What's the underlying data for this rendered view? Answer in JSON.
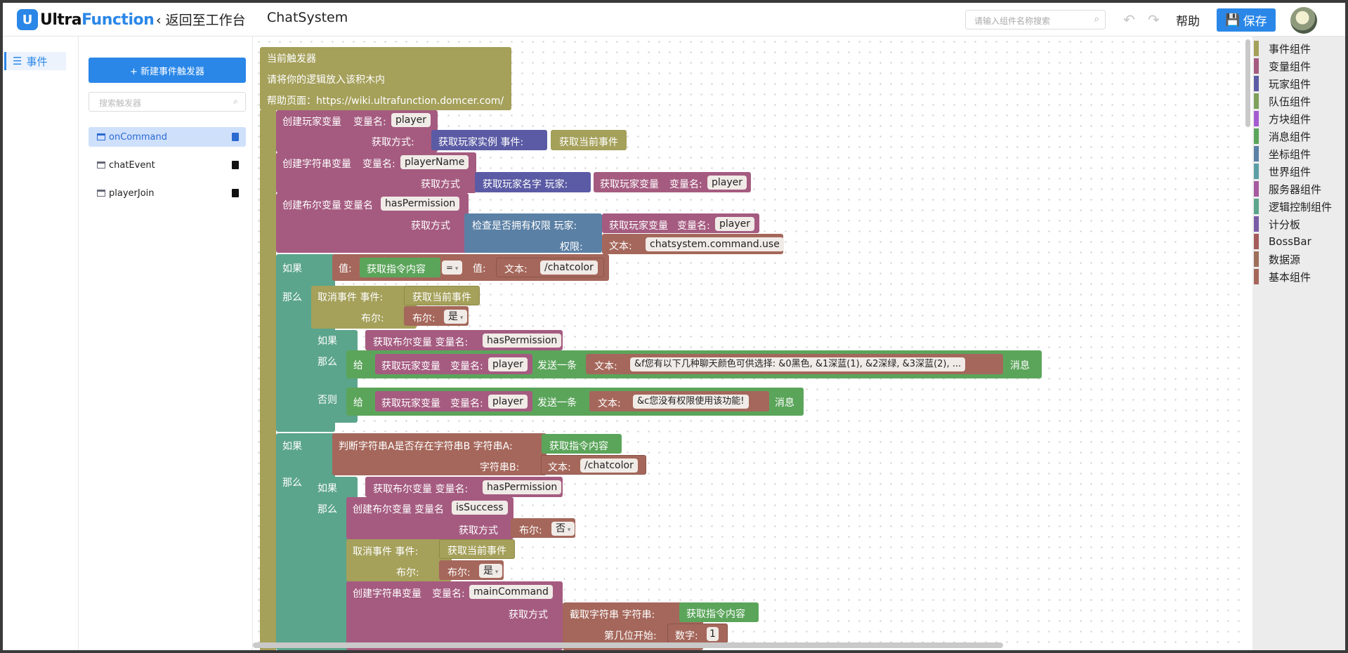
{
  "header": {
    "logo_badge": "U",
    "logo_part1": "Ultra",
    "logo_part2": "Function",
    "back_label": "返回至工作台",
    "system_name": "ChatSystem",
    "search_placeholder": "请输入组件名称搜索",
    "help_label": "帮助",
    "save_label": "保存"
  },
  "nav": {
    "active_label": "事件"
  },
  "triggers": {
    "new_button_label": "+ 新建事件触发器",
    "search_placeholder": "搜索触发器",
    "items": [
      {
        "label": "onCommand",
        "selected": true
      },
      {
        "label": "chatEvent",
        "selected": false
      },
      {
        "label": "playerJoin",
        "selected": false
      }
    ]
  },
  "palette": [
    {
      "label": "事件组件",
      "color": "#a5a05a"
    },
    {
      "label": "变量组件",
      "color": "#a55b80"
    },
    {
      "label": "玩家组件",
      "color": "#5b5ba5"
    },
    {
      "label": "队伍组件",
      "color": "#7ea05a"
    },
    {
      "label": "方块组件",
      "color": "#a55bd0"
    },
    {
      "label": "消息组件",
      "color": "#5ba55b"
    },
    {
      "label": "坐标组件",
      "color": "#5b80a5"
    },
    {
      "label": "世界组件",
      "color": "#5b9fa5"
    },
    {
      "label": "服务器组件",
      "color": "#a55b9f"
    },
    {
      "label": "逻辑控制组件",
      "color": "#5ba58c"
    },
    {
      "label": "计分板",
      "color": "#7a5ba5"
    },
    {
      "label": "BossBar",
      "color": "#a55b5b"
    },
    {
      "label": "数据源",
      "color": "#9e6f5a"
    },
    {
      "label": "基本组件",
      "color": "#a5675b"
    }
  ],
  "colors": {
    "event": "#a5a05a",
    "variable": "#a55b80",
    "player": "#5b5ba5",
    "logic": "#5ba58c",
    "message": "#5ba55b",
    "position": "#5b80a5",
    "text": "#a5675b",
    "accent": "#2a87e8"
  },
  "blocks": {
    "trigger_title": "当前触发器",
    "trigger_line2": "请将你的逻辑放入该积木内",
    "trigger_line3": "帮助页面：https://wiki.ultrafunction.domcer.com/",
    "create_player_var": "创建玩家变量",
    "var_name_label": "变量名:",
    "var_name_label_b": "变量名",
    "player_val": "player",
    "get_method_colon": "获取方式:",
    "get_method": "获取方式",
    "get_player_instance": "获取玩家实例 事件:",
    "get_current_event": "获取当前事件",
    "create_string_var": "创建字符串变量",
    "player_name_val": "playerName",
    "get_player_name": "获取玩家名字 玩家:",
    "get_player_var": "获取玩家变量",
    "create_bool_var": "创建布尔变量",
    "has_permission_val": "hasPermission",
    "check_permission": "检查是否拥有权限 玩家:",
    "permission_label": "权限:",
    "text_label": "文本:",
    "permission_val": "chatsystem.command.use",
    "if_label": "如果",
    "then_label": "那么",
    "else_label": "否则",
    "value_label": "值:",
    "get_command_content": "获取指令内容",
    "eq_op": "=",
    "chatcolor_val": "/chatcolor",
    "cancel_event": "取消事件 事件:",
    "bool_label": "布尔:",
    "yes_val": "是",
    "no_val": "否",
    "get_bool_var": "获取布尔变量 变量名:",
    "give_label": "给",
    "send_one": "发送一条",
    "msg_text_1": "&f您有以下几种聊天颜色可供选择: &0黑色, &1深蓝(1), &2深绿, &3深蓝(2), ...",
    "msg_suffix": "消息",
    "msg_text_2": "&c您没有权限使用该功能!",
    "string_contains": "判断字符串A是否存在字符串B 字符串A:",
    "string_b_label": "字符串B:",
    "is_success_val": "isSuccess",
    "main_command_val": "mainCommand",
    "substring_label": "截取字符串 字符串:",
    "start_pos_label": "第几位开始:",
    "number_label": "数字:",
    "number_val": "1"
  }
}
